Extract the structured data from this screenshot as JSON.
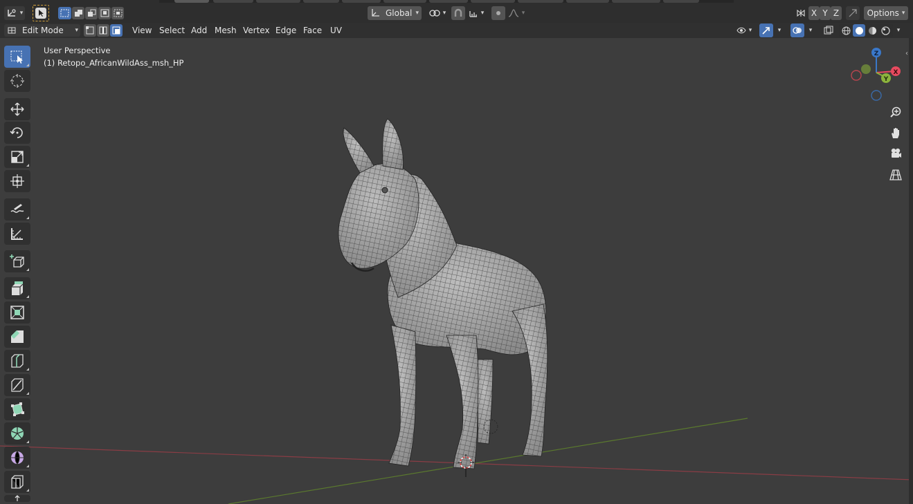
{
  "header": {
    "transform_orientation": "Global",
    "axis_buttons": [
      "X",
      "Y",
      "Z"
    ],
    "options_label": "Options"
  },
  "mode_row": {
    "mode_label": "Edit Mode",
    "menus": [
      "View",
      "Select",
      "Add",
      "Mesh",
      "Vertex",
      "Edge",
      "Face",
      "UV"
    ]
  },
  "viewport": {
    "view_name": "User Perspective",
    "object_label": "(1) Retopo_AfricanWildAss_msh_HP"
  },
  "gizmo": {
    "z": "Z",
    "y": "Y",
    "x": "X"
  },
  "colors": {
    "accent": "#4772b3",
    "x_axis": "#e84a5f",
    "y_axis": "#8cb33c",
    "z_axis": "#3a78c9"
  }
}
